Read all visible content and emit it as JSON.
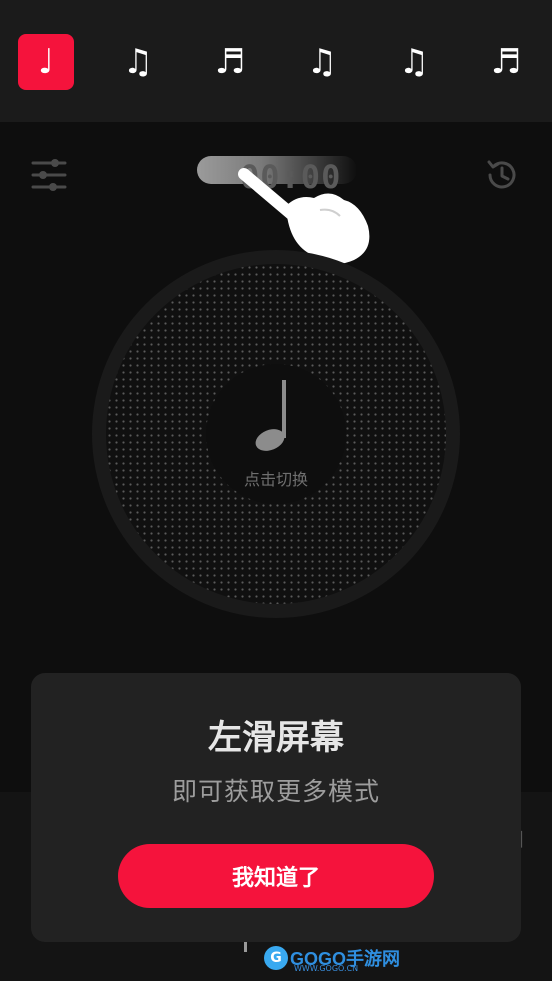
{
  "rhythm_tabs": [
    {
      "id": "quarter",
      "glyph": "♩",
      "icon": "quarter-note-icon",
      "active": true
    },
    {
      "id": "eighths",
      "glyph": "♫",
      "icon": "eighth-notes-icon",
      "active": false
    },
    {
      "id": "sixteenths",
      "glyph": "♬",
      "icon": "sixteenth-notes-icon",
      "active": false
    },
    {
      "id": "dotted-eighth-sixteenth",
      "glyph": "♫",
      "icon": "dotted-eighth-sixteenth-icon",
      "active": false
    },
    {
      "id": "sixteenth-dotted-eighth",
      "glyph": "♫",
      "icon": "sixteenth-dotted-eighth-icon",
      "active": false
    },
    {
      "id": "triplets",
      "glyph": "♬",
      "icon": "triplet-notes-icon",
      "active": false
    }
  ],
  "timer": {
    "value": "00:00"
  },
  "dial": {
    "note_icon": "quarter-note-icon",
    "hint": "点击切换"
  },
  "modal": {
    "title": "左滑屏幕",
    "subtitle": "即可获取更多模式",
    "button": "我知道了"
  },
  "watermark": {
    "logo": "G",
    "brand": "GOGO手游网",
    "url": "WWW.GOGO.CN"
  },
  "colors": {
    "accent": "#f5133c",
    "background": "#0b0b0b",
    "top_bar": "#1b1b1b",
    "modal": "#222222"
  }
}
